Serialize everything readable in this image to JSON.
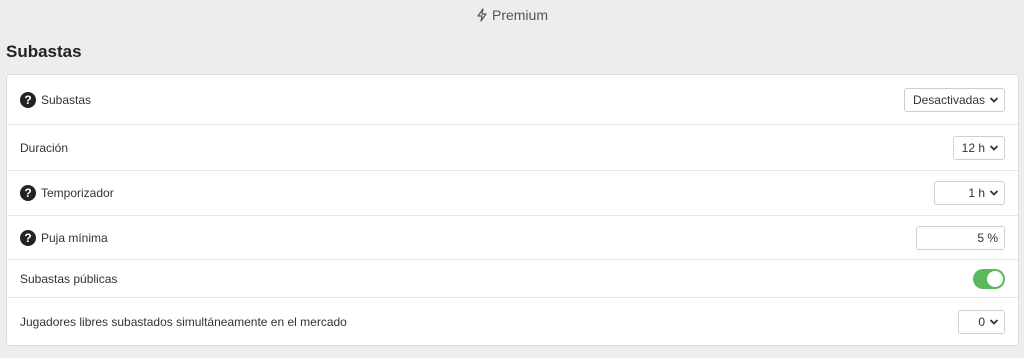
{
  "topbar": {
    "premium_label": "Premium",
    "icon": "bolt-icon"
  },
  "section": {
    "title": "Subastas"
  },
  "settings": {
    "auctions": {
      "label": "Subastas",
      "value": "Desactivadas",
      "has_help": true
    },
    "duration": {
      "label": "Duración",
      "value": "12 h",
      "has_help": false
    },
    "timer": {
      "label": "Temporizador",
      "value": "1 h",
      "has_help": true
    },
    "min_bid": {
      "label": "Puja mínima",
      "value": "5 %",
      "has_help": true
    },
    "public_auctions": {
      "label": "Subastas públicas",
      "enabled": true
    },
    "free_players": {
      "label": "Jugadores libres subastados simultáneamente en el mercado",
      "value": "0"
    }
  },
  "help_glyph": "?",
  "colors": {
    "toggle_on": "#5cb85c",
    "background": "#ededed"
  }
}
